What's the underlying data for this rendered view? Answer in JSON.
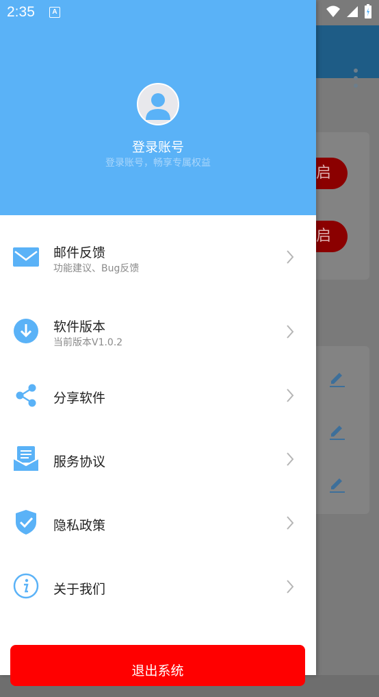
{
  "status_bar": {
    "time": "2:35",
    "notif_letter": "A"
  },
  "drawer": {
    "header": {
      "title": "登录账号",
      "subtitle": "登录账号，畅享专属权益"
    },
    "items": [
      {
        "label": "邮件反馈",
        "sub": "功能建议、Bug反馈",
        "icon": "mail-icon"
      },
      {
        "label": "软件版本",
        "sub": "当前版本V1.0.2",
        "icon": "download-icon"
      },
      {
        "label": "分享软件",
        "sub": "",
        "icon": "share-icon"
      },
      {
        "label": "服务协议",
        "sub": "",
        "icon": "agreement-icon"
      },
      {
        "label": "隐私政策",
        "sub": "",
        "icon": "shield-check-icon"
      },
      {
        "label": "关于我们",
        "sub": "",
        "icon": "info-icon"
      }
    ],
    "logout_label": "退出系统"
  },
  "background": {
    "pill_1": "启",
    "pill_2": "启"
  },
  "colors": {
    "accent": "#5ab2f7",
    "logout": "#ff0000",
    "toolbar": "#1e5c86"
  }
}
